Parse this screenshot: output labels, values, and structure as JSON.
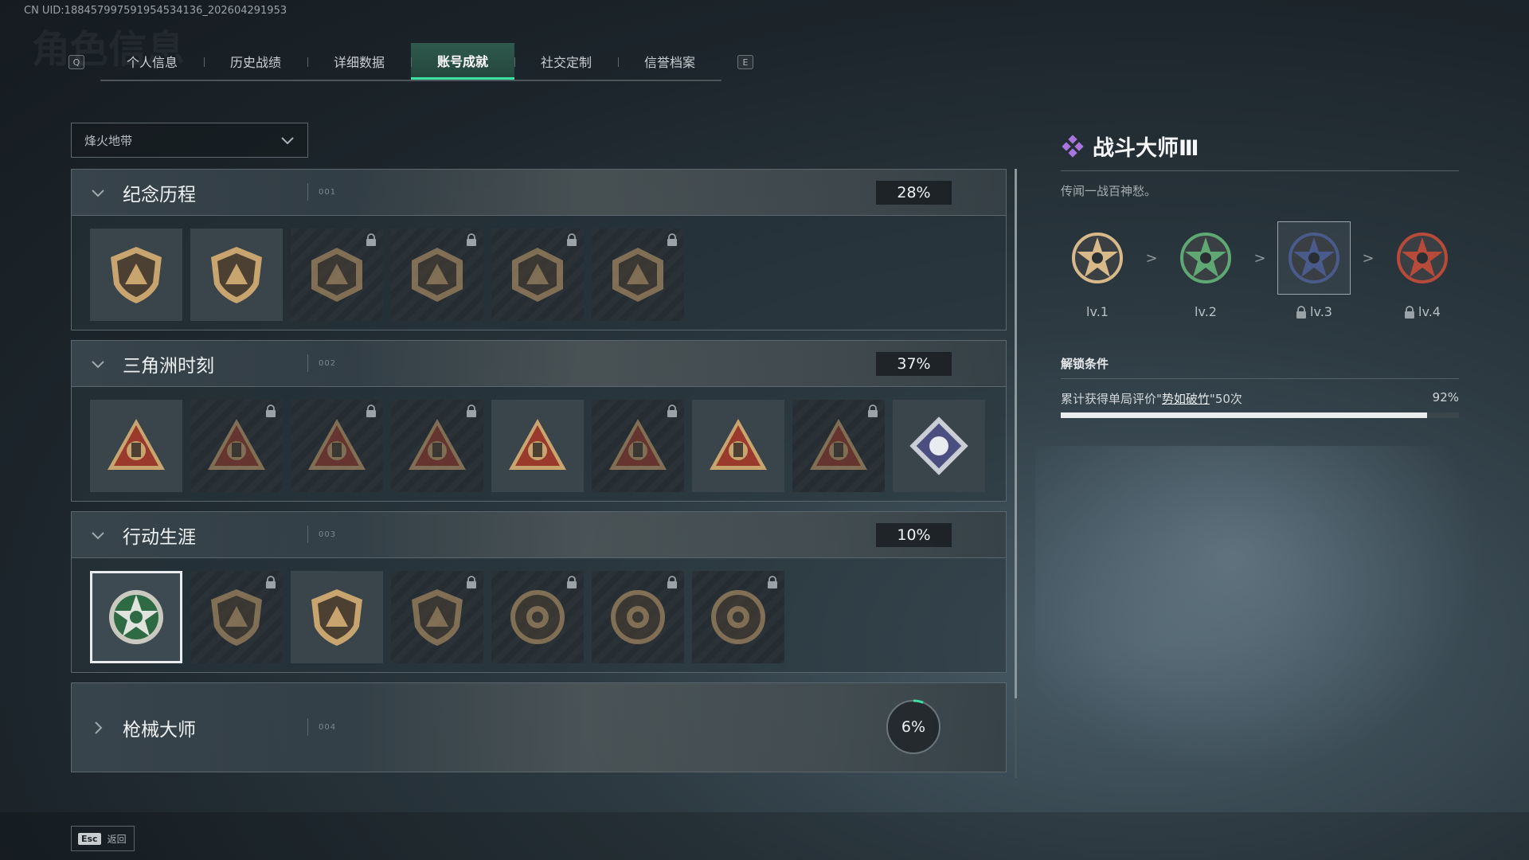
{
  "uid": "CN UID:188457997591954534136_202604291953",
  "ghost_title": "角色信息",
  "tabbar": {
    "left_key": "Q",
    "right_key": "E",
    "tabs": [
      {
        "label": "个人信息",
        "active": false
      },
      {
        "label": "历史战绩",
        "active": false
      },
      {
        "label": "详细数据",
        "active": false
      },
      {
        "label": "账号成就",
        "active": true
      },
      {
        "label": "社交定制",
        "active": false
      },
      {
        "label": "信誉档案",
        "active": false
      }
    ]
  },
  "mode_dropdown": {
    "value": "烽火地带"
  },
  "sections": [
    {
      "title": "纪念历程",
      "code": "001",
      "percent": "28%",
      "expanded": true,
      "badges": [
        {
          "icon": "triangle-shield-badge",
          "locked": false
        },
        {
          "icon": "helicopter-shield-badge",
          "locked": false
        },
        {
          "icon": "hex-emblem-badge",
          "locked": true
        },
        {
          "icon": "tower-emblem-badge",
          "locked": true
        },
        {
          "icon": "hooded-figure-badge",
          "locked": true
        },
        {
          "icon": "skull-swords-badge",
          "locked": true
        }
      ]
    },
    {
      "title": "三角洲时刻",
      "code": "002",
      "percent": "37%",
      "expanded": true,
      "badges": [
        {
          "icon": "red-triangle-flashdrive-badge",
          "locked": false
        },
        {
          "icon": "red-triangle-vest-badge",
          "locked": true
        },
        {
          "icon": "red-triangle-soldier-badge",
          "locked": true
        },
        {
          "icon": "red-triangle-star-badge",
          "locked": true
        },
        {
          "icon": "red-triangle-squad-badge",
          "locked": false
        },
        {
          "icon": "red-triangle-sniper-badge",
          "locked": true
        },
        {
          "icon": "red-triangle-rocket-badge",
          "locked": false
        },
        {
          "icon": "red-triangle-fish-badge",
          "locked": true
        },
        {
          "icon": "diamond-fist-badge",
          "locked": false
        }
      ]
    },
    {
      "title": "行动生涯",
      "code": "003",
      "percent": "10%",
      "expanded": true,
      "badges": [
        {
          "icon": "green-star-skull-badge",
          "locked": false,
          "selected": true
        },
        {
          "icon": "shield-vest-badge",
          "locked": true
        },
        {
          "icon": "shield-ring-badge",
          "locked": false
        },
        {
          "icon": "shield-hex-badge",
          "locked": true
        },
        {
          "icon": "round-helmet-badge",
          "locked": true
        },
        {
          "icon": "round-crosshair-badge",
          "locked": true
        },
        {
          "icon": "round-eye-badge",
          "locked": true
        }
      ]
    },
    {
      "title": "枪械大师",
      "code": "004",
      "percent": "6%",
      "expanded": false,
      "progress": 0.06
    }
  ],
  "detail": {
    "title": "战斗大师Ⅲ",
    "description": "传闻一战百神愁。",
    "levels": [
      {
        "label": "lv.1",
        "locked": false,
        "color": "#d8b98a"
      },
      {
        "label": "lv.2",
        "locked": false,
        "color": "#5fa873"
      },
      {
        "label": "lv.3",
        "locked": true,
        "current": true,
        "color": "#4a5a8a"
      },
      {
        "label": "lv.4",
        "locked": true,
        "color": "#b84a3a"
      }
    ],
    "arrow": ">",
    "unlock_title": "解锁条件",
    "condition": {
      "prefix": "累计获得单局评价\"",
      "highlight": "势如破竹",
      "suffix": "\"50次",
      "percent": "92%",
      "progress": 0.92
    }
  },
  "footer": {
    "key": "Esc",
    "label": "返回"
  },
  "colors": {
    "accent": "#3ee0a4",
    "bronze": "#c8a46e",
    "tri_red": "#9a3a2c"
  }
}
